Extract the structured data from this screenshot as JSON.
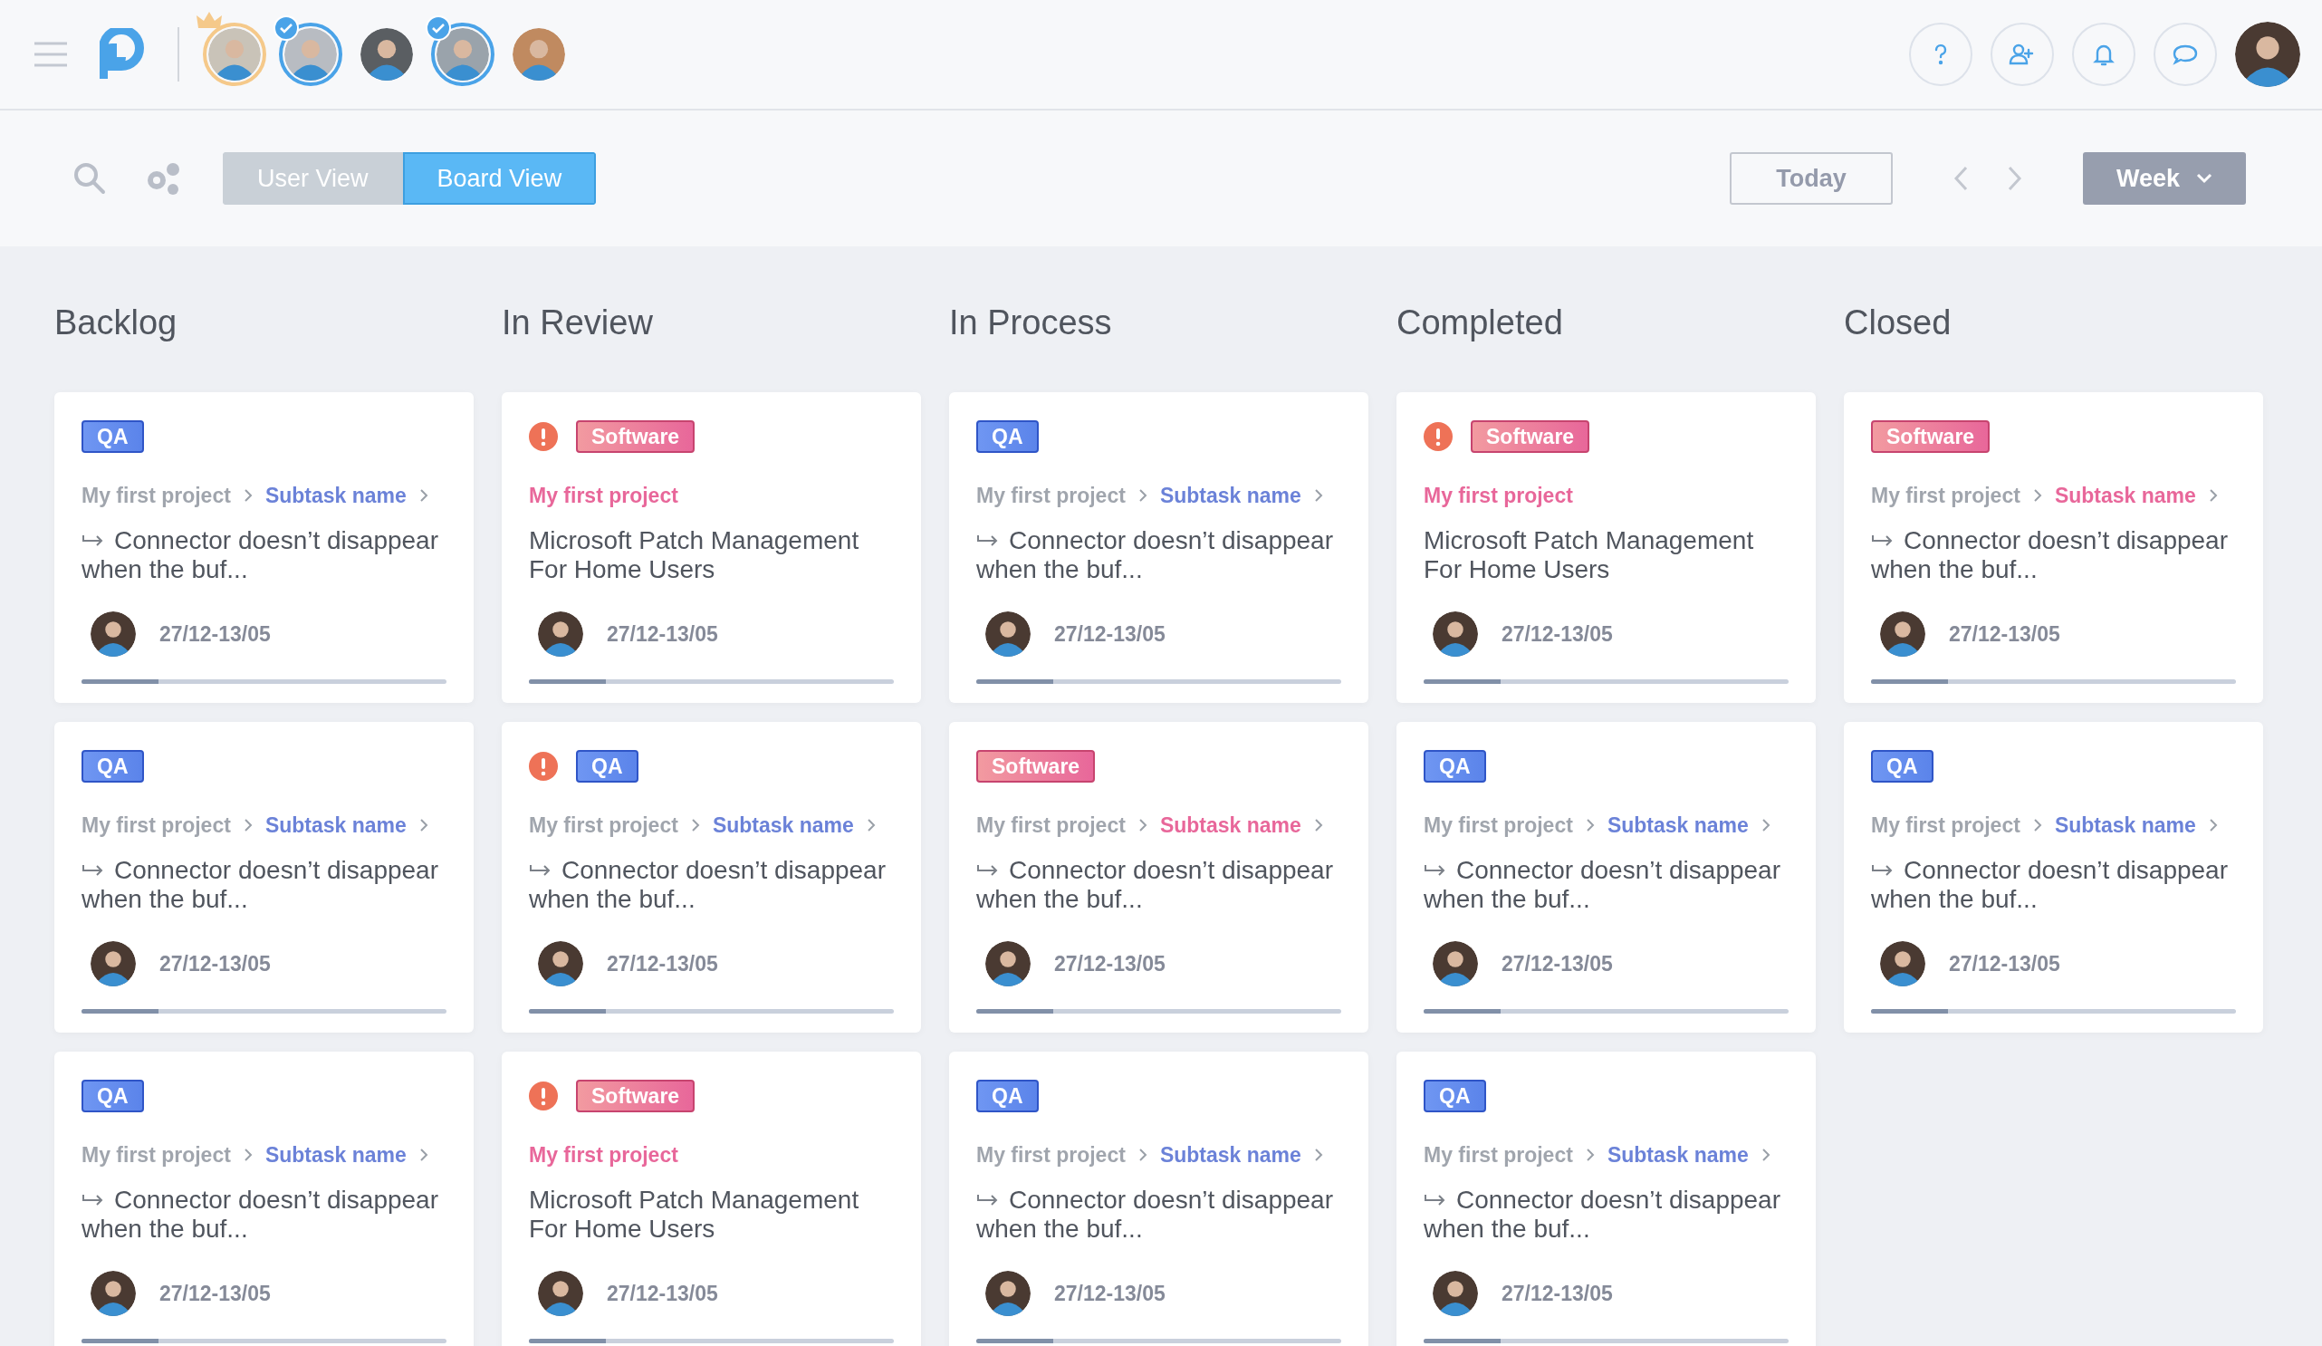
{
  "team": [
    {
      "owner": true,
      "selected": false
    },
    {
      "owner": false,
      "selected": true
    },
    {
      "owner": false,
      "selected": false
    },
    {
      "owner": false,
      "selected": true
    },
    {
      "owner": false,
      "selected": false
    }
  ],
  "toolbar": {
    "views": [
      {
        "label": "User View",
        "selected": false
      },
      {
        "label": "Board View",
        "selected": true
      }
    ],
    "today": "Today",
    "period": "Week"
  },
  "columns": [
    {
      "title": "Backlog",
      "cards": [
        {
          "kind": "subtask",
          "alert": false,
          "tag": {
            "label": "QA",
            "kind": "qa"
          },
          "project": "My first project",
          "subtask": "Subtask name",
          "title": "Connector doesn’t disappear when the buf...",
          "dates": "27/12-13/05",
          "level": 0.21
        },
        {
          "kind": "subtask",
          "alert": false,
          "tag": {
            "label": "QA",
            "kind": "qa"
          },
          "project": "My first project",
          "subtask": "Subtask name",
          "title": "Connector doesn’t disappear when the buf...",
          "dates": "27/12-13/05",
          "level": 0.21
        },
        {
          "kind": "subtask",
          "alert": false,
          "tag": {
            "label": "QA",
            "kind": "qa"
          },
          "project": "My first project",
          "subtask": "Subtask name",
          "title": "Connector doesn’t disappear when the buf...",
          "dates": "27/12-13/05",
          "level": 0.21
        }
      ]
    },
    {
      "title": "In Review",
      "cards": [
        {
          "kind": "task",
          "alert": true,
          "tag": {
            "label": "Software",
            "kind": "software"
          },
          "project": "My first project",
          "title": "Microsoft Patch Management For Home Users",
          "dates": "27/12-13/05",
          "level": 0.21
        },
        {
          "kind": "subtask",
          "alert": true,
          "tag": {
            "label": "QA",
            "kind": "qa"
          },
          "project": "My first project",
          "subtask": "Subtask name",
          "title": "Connector doesn’t disappear when the buf...",
          "dates": "27/12-13/05",
          "level": 0.21
        },
        {
          "kind": "task",
          "alert": true,
          "tag": {
            "label": "Software",
            "kind": "software"
          },
          "project": "My first project",
          "title": "Microsoft Patch Management For Home Users",
          "dates": "27/12-13/05",
          "level": 0.21
        }
      ]
    },
    {
      "title": "In Process",
      "cards": [
        {
          "kind": "subtask",
          "alert": false,
          "tag": {
            "label": "QA",
            "kind": "qa"
          },
          "project": "My first project",
          "subtask": "Subtask name",
          "title": "Connector doesn’t disappear when the buf...",
          "dates": "27/12-13/05",
          "level": 0.21
        },
        {
          "kind": "subtask",
          "alert": false,
          "tag": {
            "label": "Software",
            "kind": "software"
          },
          "project": "My first project",
          "subtask": "Subtask name",
          "title": "Connector doesn’t disappear when the buf...",
          "dates": "27/12-13/05",
          "level": 0.21
        },
        {
          "kind": "subtask",
          "alert": false,
          "tag": {
            "label": "QA",
            "kind": "qa"
          },
          "project": "My first project",
          "subtask": "Subtask name",
          "title": "Connector doesn’t disappear when the buf...",
          "dates": "27/12-13/05",
          "level": 0.21
        }
      ]
    },
    {
      "title": "Completed",
      "cards": [
        {
          "kind": "task",
          "alert": true,
          "tag": {
            "label": "Software",
            "kind": "software"
          },
          "project": "My first project",
          "title": "Microsoft Patch Management For Home Users",
          "dates": "27/12-13/05",
          "level": 0.21
        },
        {
          "kind": "subtask",
          "alert": false,
          "tag": {
            "label": "QA",
            "kind": "qa"
          },
          "project": "My first project",
          "subtask": "Subtask name",
          "title": "Connector doesn’t disappear when the buf...",
          "dates": "27/12-13/05",
          "level": 0.21
        },
        {
          "kind": "subtask",
          "alert": false,
          "tag": {
            "label": "QA",
            "kind": "qa"
          },
          "project": "My first project",
          "subtask": "Subtask name",
          "title": "Connector doesn’t disappear when the buf...",
          "dates": "27/12-13/05",
          "level": 0.21
        }
      ]
    },
    {
      "title": "Closed",
      "cards": [
        {
          "kind": "subtask",
          "alert": false,
          "tag": {
            "label": "Software",
            "kind": "software"
          },
          "project": "My first project",
          "subtask": "Subtask name",
          "title": "Connector doesn’t disappear when the buf...",
          "dates": "27/12-13/05",
          "level": 0.21
        },
        {
          "kind": "subtask",
          "alert": false,
          "tag": {
            "label": "QA",
            "kind": "qa"
          },
          "project": "My first project",
          "subtask": "Subtask name",
          "title": "Connector doesn’t disappear when the buf...",
          "dates": "27/12-13/05",
          "level": 0.21
        }
      ]
    }
  ]
}
